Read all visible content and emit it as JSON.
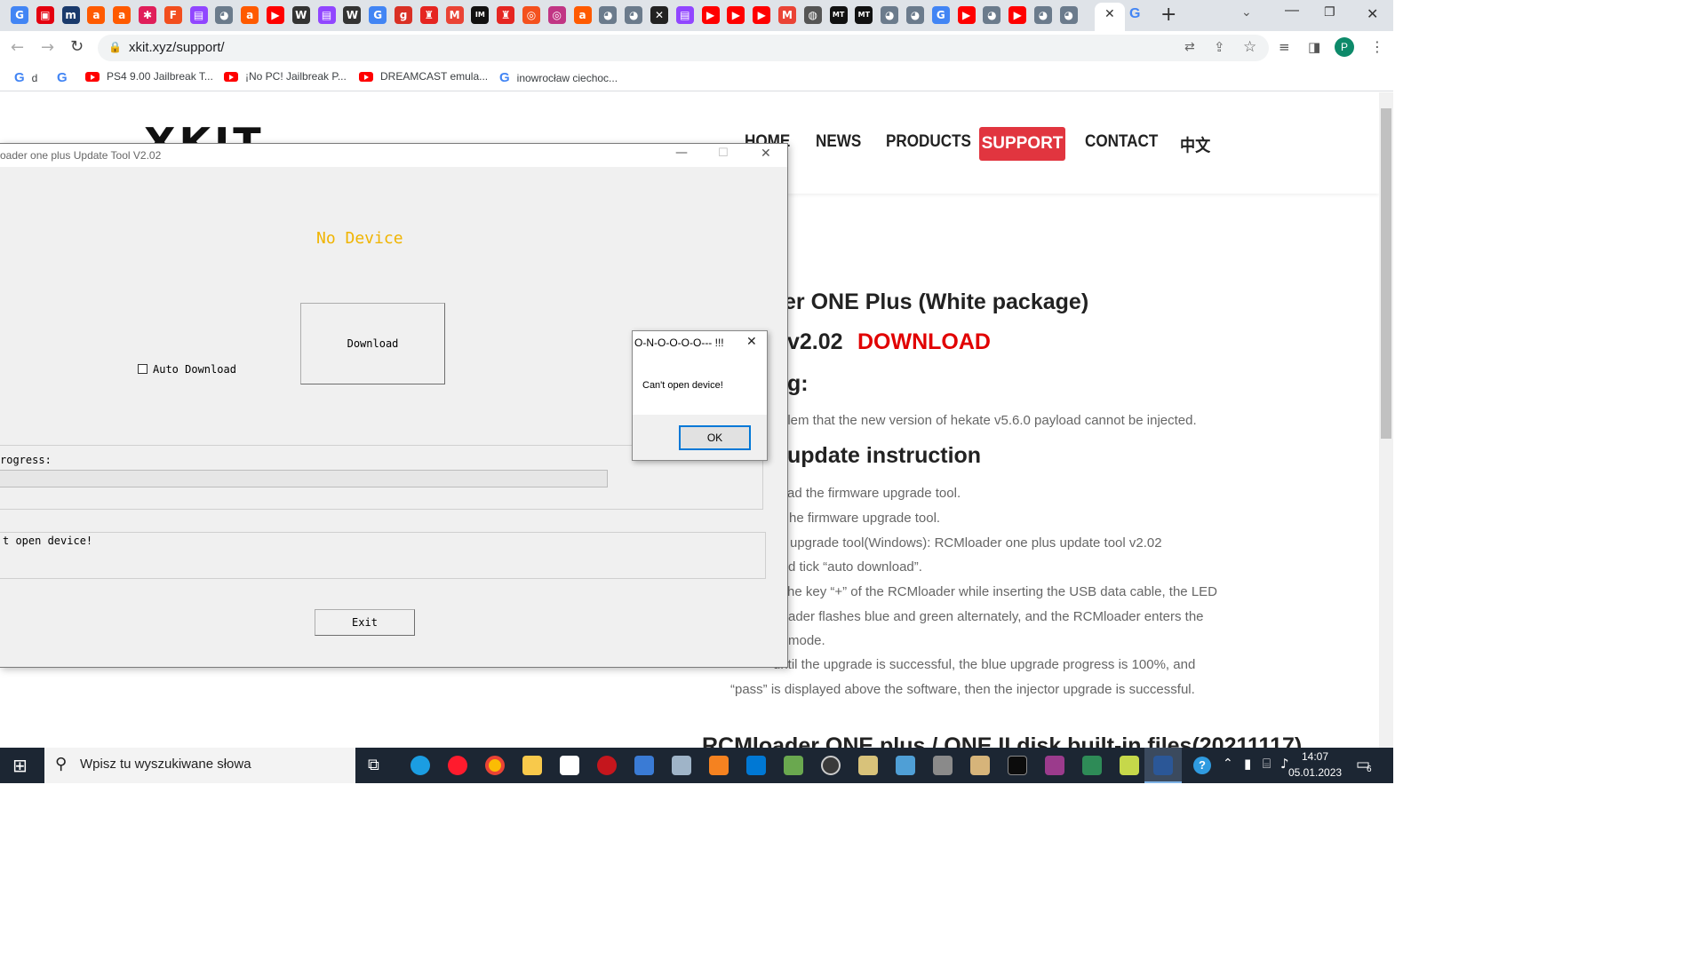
{
  "browser": {
    "tab_icons": [
      {
        "name": "google-icon",
        "color": "#4285f4",
        "glyph": "G"
      },
      {
        "name": "nintendo-icon",
        "color": "#e4000f",
        "glyph": "▣"
      },
      {
        "name": "m-icon",
        "color": "#1a3a6c",
        "glyph": "m"
      },
      {
        "name": "allegro-icon",
        "color": "#ff5a00",
        "glyph": "a"
      },
      {
        "name": "allegro-icon",
        "color": "#ff5a00",
        "glyph": "a"
      },
      {
        "name": "slack-icon",
        "color": "#e01e5a",
        "glyph": "✱"
      },
      {
        "name": "figma-icon",
        "color": "#f24e1e",
        "glyph": "F"
      },
      {
        "name": "twitch-icon",
        "color": "#9146ff",
        "glyph": "▤"
      },
      {
        "name": "cat-icon",
        "color": "#6b7b8c",
        "glyph": "◕"
      },
      {
        "name": "allegro-icon",
        "color": "#ff5a00",
        "glyph": "a"
      },
      {
        "name": "youtube-icon",
        "color": "#ff0000",
        "glyph": "▶"
      },
      {
        "name": "wikipedia-icon",
        "color": "#333333",
        "glyph": "W"
      },
      {
        "name": "twitch-icon",
        "color": "#9146ff",
        "glyph": "▤"
      },
      {
        "name": "wikipedia-icon",
        "color": "#333333",
        "glyph": "W"
      },
      {
        "name": "google-icon",
        "color": "#4285f4",
        "glyph": "G"
      },
      {
        "name": "g-red-icon",
        "color": "#d93025",
        "glyph": "g"
      },
      {
        "name": "mario-icon",
        "color": "#e52521",
        "glyph": "♜"
      },
      {
        "name": "gmail-icon",
        "color": "#ea4335",
        "glyph": "M"
      },
      {
        "name": "im-icon",
        "color": "#111111",
        "glyph": "IM"
      },
      {
        "name": "mario-icon",
        "color": "#e52521",
        "glyph": "♜"
      },
      {
        "name": "swirl-icon",
        "color": "#f4511e",
        "glyph": "◎"
      },
      {
        "name": "instagram-icon",
        "color": "#c13584",
        "glyph": "◎"
      },
      {
        "name": "allegro-icon",
        "color": "#ff5a00",
        "glyph": "a"
      },
      {
        "name": "cat-icon",
        "color": "#6b7b8c",
        "glyph": "◕"
      },
      {
        "name": "cat-icon",
        "color": "#6b7b8c",
        "glyph": "◕"
      },
      {
        "name": "x-tools-icon",
        "color": "#222222",
        "glyph": "✕"
      },
      {
        "name": "twitch-icon",
        "color": "#9146ff",
        "glyph": "▤"
      },
      {
        "name": "youtube-icon",
        "color": "#ff0000",
        "glyph": "▶"
      },
      {
        "name": "youtube-icon",
        "color": "#ff0000",
        "glyph": "▶"
      },
      {
        "name": "youtube-icon",
        "color": "#ff0000",
        "glyph": "▶"
      },
      {
        "name": "gmail-icon",
        "color": "#ea4335",
        "glyph": "M"
      },
      {
        "name": "globe-icon",
        "color": "#555555",
        "glyph": "◍"
      },
      {
        "name": "mt-icon",
        "color": "#111111",
        "glyph": "MT"
      },
      {
        "name": "mt-icon",
        "color": "#111111",
        "glyph": "MT"
      },
      {
        "name": "cat-icon",
        "color": "#6b7b8c",
        "glyph": "◕"
      },
      {
        "name": "cat-icon",
        "color": "#6b7b8c",
        "glyph": "◕"
      },
      {
        "name": "google-icon",
        "color": "#4285f4",
        "glyph": "G"
      },
      {
        "name": "youtube-icon",
        "color": "#ff0000",
        "glyph": "▶"
      },
      {
        "name": "cat-icon",
        "color": "#6b7b8c",
        "glyph": "◕"
      },
      {
        "name": "youtube-icon",
        "color": "#ff0000",
        "glyph": "▶"
      },
      {
        "name": "cat-icon",
        "color": "#6b7b8c",
        "glyph": "◕"
      },
      {
        "name": "cat-icon",
        "color": "#6b7b8c",
        "glyph": "◕"
      }
    ],
    "url": "xkit.xyz/support/",
    "profile_initial": "P",
    "bookmarks": [
      {
        "label": "d",
        "icon": "google-icon"
      },
      {
        "label": "",
        "icon": "google-icon"
      },
      {
        "label": "PS4 9.00 Jailbreak T...",
        "icon": "youtube-icon"
      },
      {
        "label": "¡No PC! Jailbreak P...",
        "icon": "youtube-icon"
      },
      {
        "label": "DREAMCAST emula...",
        "icon": "youtube-icon"
      },
      {
        "label": "inowrocław ciechoc...",
        "icon": "google-icon"
      }
    ]
  },
  "site": {
    "logo": "XKIT",
    "nav": {
      "home": "HOME",
      "news": "NEWS",
      "products": "PRODUCTS",
      "support": "SUPPORT",
      "contact": "CONTACT",
      "lang": "中文"
    },
    "heading1": "er ONE Plus (White package)",
    "version": "v2.02",
    "download": "DOWNLOAD",
    "heading_g": "g:",
    "fix_text": "blem that the new version of hekate v5.6.0 payload cannot be injected.",
    "heading_update": "update instruction",
    "steps": [
      "ad the firmware upgrade tool.",
      "he firmware upgrade tool.",
      "upgrade tool(Windows): RCMloader one plus update tool v2.02",
      "d tick “auto download”.",
      "he key “+” of the RCMloader while inserting the USB data cable, the LED",
      "ader flashes blue and green alternately, and the RCMloader enters the",
      "mode.",
      "until the upgrade is successful, the blue upgrade progress is 100%, and",
      "“pass” is displayed above the software, then the injector upgrade is successful."
    ],
    "bottom_heading": "RCMloader ONE plus / ONE II disk built-in files(20211117)"
  },
  "app": {
    "title": "oader one plus Update Tool V2.02",
    "status": "No Device",
    "download_button": "Download",
    "auto_download_label": "Auto Download",
    "progress_label": "rogress:",
    "progress": 0,
    "log_text": "t open device!",
    "exit_button": "Exit"
  },
  "dialog": {
    "title": "O-N-O-O-O-O--- !!!",
    "message": "Can't open device!",
    "ok_button": "OK"
  },
  "taskbar": {
    "search_placeholder": "Wpisz tu wyszukiwane słowa",
    "time": "14:07",
    "date": "05.01.2023",
    "notification_count": "6"
  },
  "colors": {
    "accent_red": "#e1353f",
    "download_red": "#e10000",
    "status_yellow": "#f0b400",
    "taskbar": "#1c2633"
  }
}
